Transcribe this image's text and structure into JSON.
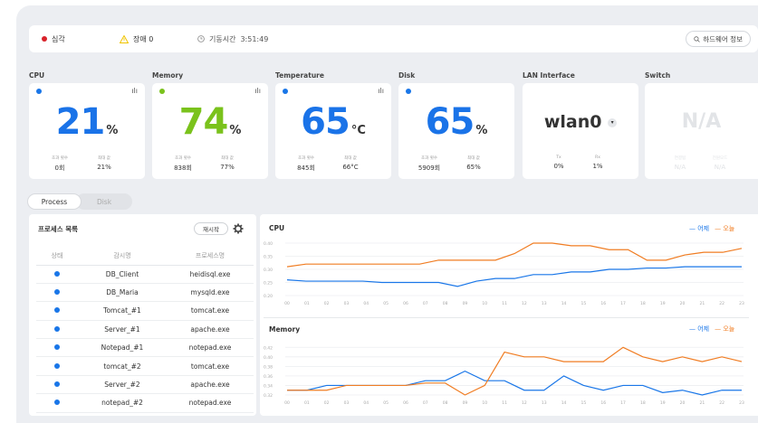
{
  "topbar": {
    "critical_label": "심각",
    "warning_label": "장애 0",
    "uptime_label": "기동시간",
    "uptime_value": "3:51:49",
    "hw_button": "하드웨어 정보"
  },
  "cards": [
    {
      "title": "CPU",
      "value": "21",
      "unit": "%",
      "color": "#1a73e8",
      "dot": "#1976e8",
      "l1": "초과 횟수",
      "v1": "0회",
      "l2": "최대 값",
      "v2": "21%"
    },
    {
      "title": "Memory",
      "value": "74",
      "unit": "%",
      "color": "#7ac21c",
      "dot": "#7ac21c",
      "l1": "초과 횟수",
      "v1": "838회",
      "l2": "최대 값",
      "v2": "77%"
    },
    {
      "title": "Temperature",
      "value": "65",
      "unit": "°C",
      "color": "#1a73e8",
      "dot": "#1976e8",
      "l1": "초과 횟수",
      "v1": "845회",
      "l2": "최대 값",
      "v2": "66°C"
    },
    {
      "title": "Disk",
      "value": "65",
      "unit": "%",
      "color": "#1a73e8",
      "dot": "#1976e8",
      "l1": "초과 횟수",
      "v1": "5909회",
      "l2": "최대 값",
      "v2": "65%"
    },
    {
      "title": "LAN Interface",
      "value": "wlan0",
      "l1": "Tx",
      "v1": "0%",
      "l2": "Rx",
      "v2": "1%"
    },
    {
      "title": "Switch",
      "value": "N/A",
      "l1": "연결됨",
      "v1": "N/A",
      "l2": "전원모드",
      "v2": "N/A"
    }
  ],
  "tabs": [
    "Process",
    "Disk"
  ],
  "process": {
    "title": "프로세스 목록",
    "restart": "재시작",
    "headers": [
      "상태",
      "감시명",
      "프로세스명"
    ],
    "rows": [
      [
        "DB_Client",
        "heidisql.exe"
      ],
      [
        "DB_Maria",
        "mysqld.exe"
      ],
      [
        "Tomcat_#1",
        "tomcat.exe"
      ],
      [
        "Server_#1",
        "apache.exe"
      ],
      [
        "Notepad_#1",
        "notepad.exe"
      ],
      [
        "tomcat_#2",
        "tomcat.exe"
      ],
      [
        "Server_#2",
        "apache.exe"
      ],
      [
        "notepad_#2",
        "notepad.exe"
      ]
    ]
  },
  "legend": {
    "yesterday": "어제",
    "today": "오늘",
    "yesterday_color": "#1976e8",
    "today_color": "#f07c22"
  },
  "chart_data": [
    {
      "type": "line",
      "title": "CPU",
      "x": [
        "00",
        "01",
        "02",
        "03",
        "04",
        "05",
        "06",
        "07",
        "08",
        "09",
        "10",
        "11",
        "12",
        "13",
        "14",
        "15",
        "16",
        "17",
        "18",
        "19",
        "20",
        "21",
        "22",
        "23"
      ],
      "yticks": [
        "0.40",
        "0.35",
        "0.30",
        "0.25",
        "0.20"
      ],
      "ylim": [
        0.2,
        0.4
      ],
      "series": [
        {
          "name": "어제",
          "values": [
            0.26,
            0.255,
            0.255,
            0.255,
            0.255,
            0.25,
            0.25,
            0.25,
            0.25,
            0.235,
            0.255,
            0.265,
            0.265,
            0.28,
            0.28,
            0.29,
            0.29,
            0.3,
            0.3,
            0.305,
            0.305,
            0.31,
            0.31,
            0.31,
            0.31
          ]
        },
        {
          "name": "오늘",
          "values": [
            0.31,
            0.32,
            0.32,
            0.32,
            0.32,
            0.32,
            0.32,
            0.32,
            0.335,
            0.335,
            0.335,
            0.335,
            0.36,
            0.4,
            0.4,
            0.39,
            0.39,
            0.375,
            0.375,
            0.335,
            0.335,
            0.355,
            0.365,
            0.365,
            0.38
          ]
        }
      ]
    },
    {
      "type": "line",
      "title": "Memory",
      "x": [
        "00",
        "01",
        "02",
        "03",
        "04",
        "05",
        "06",
        "07",
        "08",
        "09",
        "10",
        "11",
        "12",
        "13",
        "14",
        "15",
        "16",
        "17",
        "18",
        "19",
        "20",
        "21",
        "22",
        "23"
      ],
      "yticks": [
        "0.42",
        "0.40",
        "0.38",
        "0.36",
        "0.34",
        "0.32"
      ],
      "ylim": [
        0.32,
        0.43
      ],
      "series": [
        {
          "name": "어제",
          "values": [
            0.33,
            0.33,
            0.34,
            0.34,
            0.34,
            0.34,
            0.34,
            0.35,
            0.35,
            0.37,
            0.35,
            0.35,
            0.33,
            0.33,
            0.36,
            0.34,
            0.33,
            0.34,
            0.34,
            0.325,
            0.33,
            0.32,
            0.33,
            0.33
          ]
        },
        {
          "name": "오늘",
          "values": [
            0.33,
            0.33,
            0.33,
            0.34,
            0.34,
            0.34,
            0.34,
            0.345,
            0.345,
            0.32,
            0.34,
            0.41,
            0.4,
            0.4,
            0.39,
            0.39,
            0.39,
            0.42,
            0.4,
            0.39,
            0.4,
            0.39,
            0.4,
            0.39
          ]
        }
      ]
    }
  ]
}
